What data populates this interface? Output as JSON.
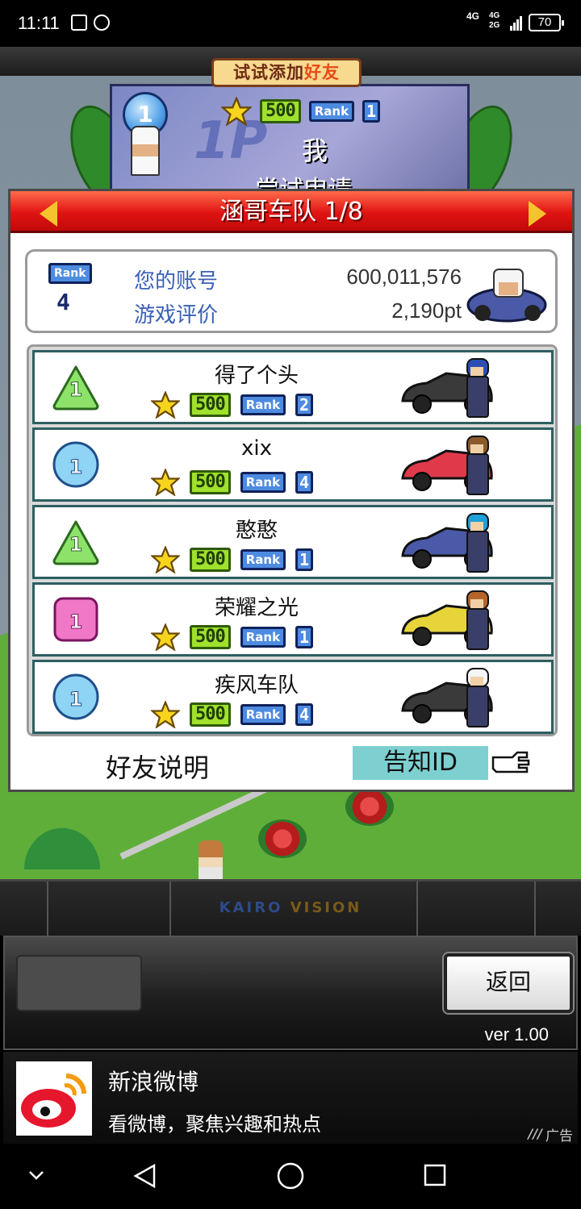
{
  "status_bar": {
    "time": "11:11",
    "network_top": "4G",
    "network_2a": "4G",
    "network_2b": "2G",
    "battery": "70"
  },
  "header": {
    "try_add_prefix": "试试添加",
    "try_add_emphasis": "好友"
  },
  "self_card": {
    "medal": "1",
    "star_count": "500",
    "rank_label": "Rank",
    "rank_value": "1",
    "name": "我",
    "status": "尝试申请"
  },
  "panel": {
    "title": "涵哥车队 1/8",
    "account": {
      "rank_label": "Rank",
      "rank_value": "4",
      "account_label": "您的账号",
      "account_value": "600,011,576",
      "rating_label": "游戏评价",
      "rating_value": "2,190pt"
    },
    "friends": [
      {
        "name": "得了个头",
        "medal": "1",
        "medal_style": "green",
        "stars": "500",
        "rank_label": "Rank",
        "rank": "2",
        "car_color": "#3a3a3a",
        "driver_color": "#2b4fb3"
      },
      {
        "name": "xix",
        "medal": "1",
        "medal_style": "blue",
        "stars": "500",
        "rank_label": "Rank",
        "rank": "4",
        "car_color": "#e03a4a",
        "driver_color": "#8a5a2a"
      },
      {
        "name": "憨憨",
        "medal": "1",
        "medal_style": "green",
        "stars": "500",
        "rank_label": "Rank",
        "rank": "1",
        "car_color": "#4a5aa8",
        "driver_color": "#1ea0d8"
      },
      {
        "name": "荣耀之光",
        "medal": "1",
        "medal_style": "pink",
        "stars": "500",
        "rank_label": "Rank",
        "rank": "1",
        "car_color": "#e6d43a",
        "driver_color": "#b5652a"
      },
      {
        "name": "疾风车队",
        "medal": "1",
        "medal_style": "blue",
        "stars": "500",
        "rank_label": "Rank",
        "rank": "4",
        "car_color": "#3a3a3a",
        "driver_color": "#f5f5f5"
      }
    ],
    "help_label": "好友说明",
    "notify_label": "告知ID"
  },
  "brand": {
    "part1": "KAIRO",
    "part2": "VISION"
  },
  "controls": {
    "back_label": "返回",
    "version": "ver 1.00"
  },
  "ad": {
    "title": "新浪微博",
    "description": "看微博，聚焦兴趣和热点",
    "tag": "广告"
  },
  "icons": {
    "star": "star-icon",
    "hand": "pointing-hand-icon",
    "nav_down": "chevron-down-icon",
    "nav_back": "triangle-back-icon",
    "nav_home": "circle-home-icon",
    "nav_recent": "square-recent-icon"
  },
  "colors": {
    "header_red": "#e01313",
    "arrow_yellow": "#f5c32e",
    "notify_bg": "#7ed0d0",
    "label_blue": "#3a5fb6"
  }
}
